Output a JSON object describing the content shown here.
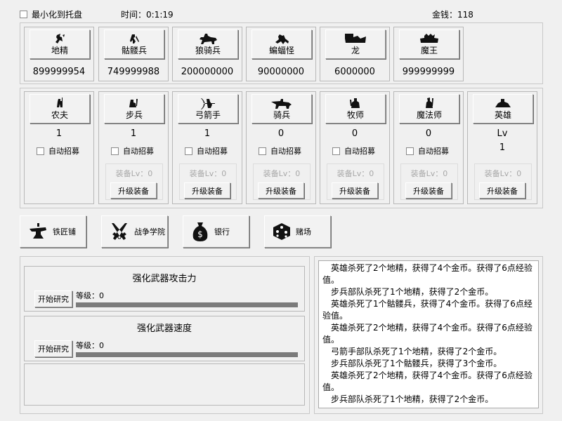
{
  "top": {
    "minimize_label": "最小化到托盘",
    "time_label": "时间：0:1:19",
    "gold_label": "金钱：118"
  },
  "enemies": [
    {
      "name": "地精",
      "count": "899999954",
      "icon": "goblin-icon"
    },
    {
      "name": "骷髅兵",
      "count": "749999988",
      "icon": "skeleton-icon"
    },
    {
      "name": "狼骑兵",
      "count": "200000000",
      "icon": "wolf-rider-icon"
    },
    {
      "name": "蝙蝠怪",
      "count": "90000000",
      "icon": "bat-icon"
    },
    {
      "name": "龙",
      "count": "6000000",
      "icon": "dragon-icon"
    },
    {
      "name": "魔王",
      "count": "999999999",
      "icon": "demon-king-icon"
    }
  ],
  "units": [
    {
      "name": "农夫",
      "count": "1",
      "icon": "farmer-icon"
    },
    {
      "name": "步兵",
      "count": "1",
      "icon": "infantry-icon",
      "auto": "自动招募",
      "equip": "装备Lv：0",
      "upgrade": "升级装备"
    },
    {
      "name": "弓箭手",
      "count": "1",
      "icon": "archer-icon",
      "auto": "自动招募",
      "equip": "装备Lv：0",
      "upgrade": "升级装备"
    },
    {
      "name": "骑兵",
      "count": "0",
      "icon": "cavalry-icon",
      "auto": "自动招募",
      "equip": "装备Lv：0",
      "upgrade": "升级装备"
    },
    {
      "name": "牧师",
      "count": "0",
      "icon": "priest-icon",
      "auto": "自动招募",
      "equip": "装备Lv：0",
      "upgrade": "升级装备"
    },
    {
      "name": "魔法师",
      "count": "0",
      "icon": "mage-icon",
      "auto": "自动招募",
      "equip": "装备Lv：0",
      "upgrade": "升级装备"
    }
  ],
  "farmer_auto": "自动招募",
  "hero": {
    "name": "英雄",
    "lv_label": "Lv",
    "lv": "1",
    "equip": "装备Lv：0",
    "upgrade": "升级装备",
    "icon": "hero-icon"
  },
  "buildings": [
    {
      "name": "铁匠铺",
      "icon": "anvil-icon"
    },
    {
      "name": "战争学院",
      "icon": "crossed-swords-icon"
    },
    {
      "name": "银行",
      "icon": "money-bag-icon"
    },
    {
      "name": "赌场",
      "icon": "dice-icon"
    }
  ],
  "research": [
    {
      "title": "强化武器攻击力",
      "button": "开始研究",
      "level_label": "等级：0",
      "progress": 1.0
    },
    {
      "title": "强化武器速度",
      "button": "开始研究",
      "level_label": "等级：0",
      "progress": 1.0
    }
  ],
  "log": [
    "英雄杀死了2个地精，获得了4个金币。获得了6点经验值。",
    "步兵部队杀死了1个地精，获得了2个金币。",
    "英雄杀死了1个骷髅兵，获得了4个金币。获得了6点经验值。",
    "英雄杀死了2个地精，获得了4个金币。获得了6点经验值。",
    "弓箭手部队杀死了1个地精，获得了2个金币。",
    "步兵部队杀死了1个骷髅兵，获得了3个金币。",
    "英雄杀死了2个地精，获得了4个金币。获得了6点经验值。",
    "步兵部队杀死了1个地精，获得了2个金币。"
  ]
}
